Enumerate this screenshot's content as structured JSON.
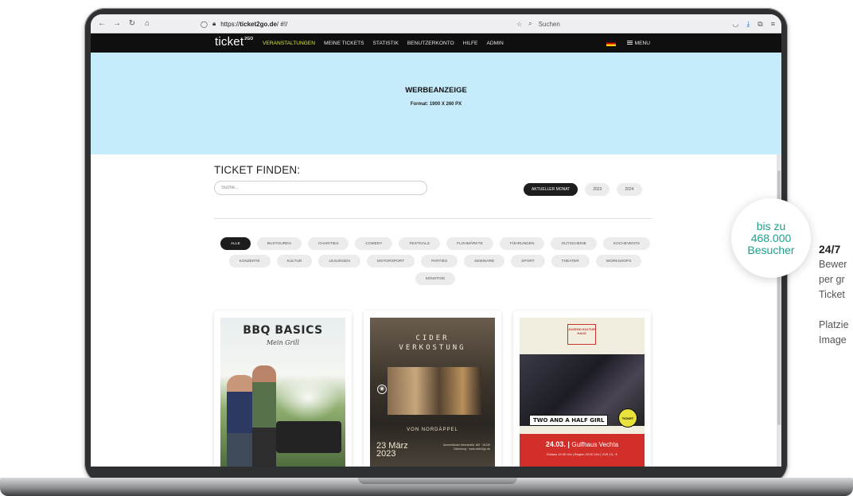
{
  "browser": {
    "url_prefix": "https://",
    "url_domain": "ticket2go.de",
    "url_path": "/ #!/",
    "search_placeholder": "Suchen"
  },
  "site": {
    "logo_text": "ticket",
    "logo_sup": "2GO",
    "nav": [
      {
        "label": "VERANSTALTUNGEN",
        "active": true
      },
      {
        "label": "MEINE TICKETS"
      },
      {
        "label": "STATISTIK"
      },
      {
        "label": "BENUTZERKONTO"
      },
      {
        "label": "HILFE"
      },
      {
        "label": "ADMIN"
      }
    ],
    "menu_label": "MENU"
  },
  "ad": {
    "title": "WERBEANZEIGE",
    "format": "Format: 1900 X 260 PX"
  },
  "finder": {
    "title": "TICKET FINDEN:",
    "search_placeholder": "Suche...",
    "month_filters": [
      "AKTUELLER MONAT",
      "2023",
      "2024"
    ],
    "categories": [
      "ALLE",
      "BUSTOUREN",
      "CHARITIES",
      "COMEDY",
      "FESTIVALS",
      "FLOHMÄRKTE",
      "FÜHRUNGEN",
      "GUTSCHEINE",
      "KOCHEVENTS",
      "KONZERTE",
      "KULTUR",
      "LESUNGEN",
      "MOTORSPORT",
      "PARTIES",
      "SEMINARE",
      "SPORT",
      "THEATER",
      "WORKSHOPS",
      "SONSTIGE"
    ]
  },
  "cards": {
    "bbq": {
      "title": "BBQ BASICS",
      "subtitle": "Mein Grill"
    },
    "cider": {
      "title_l1": "CIDER",
      "title_l2": "VERKOSTUNG",
      "from": "VON NORDÄPPEL",
      "date_l1": "23 März",
      "date_l2": "2023",
      "address": "Ammerländer Heerstraße 185 · 26129 Oldenburg · www.cider2go.de"
    },
    "concert": {
      "logo": "JUGEND KULTUR HAUS",
      "band": "TWO AND A HALF GIRL",
      "badge": "TICKET",
      "date": "24.03.",
      "venue": "Gulfhaus Vechta",
      "info": "Einlass 19:30 Uhr | Beginn 20:00 Uhr | VVK 13,- €"
    }
  },
  "overlay": {
    "badge_l1": "bis zu",
    "badge_l2": "468.000",
    "badge_l3": "Besucher",
    "side_heading": "24/7",
    "side_lines": [
      "Bewer",
      "per gr",
      "Ticket",
      "",
      "Platzie",
      "Image"
    ]
  },
  "colors": {
    "ad_background": "#c6ebfa",
    "nav_background": "#0f0f0f",
    "nav_active": "#d6e835",
    "accent_green": "#1aa28c",
    "dark_pill": "#1d1d1d"
  }
}
